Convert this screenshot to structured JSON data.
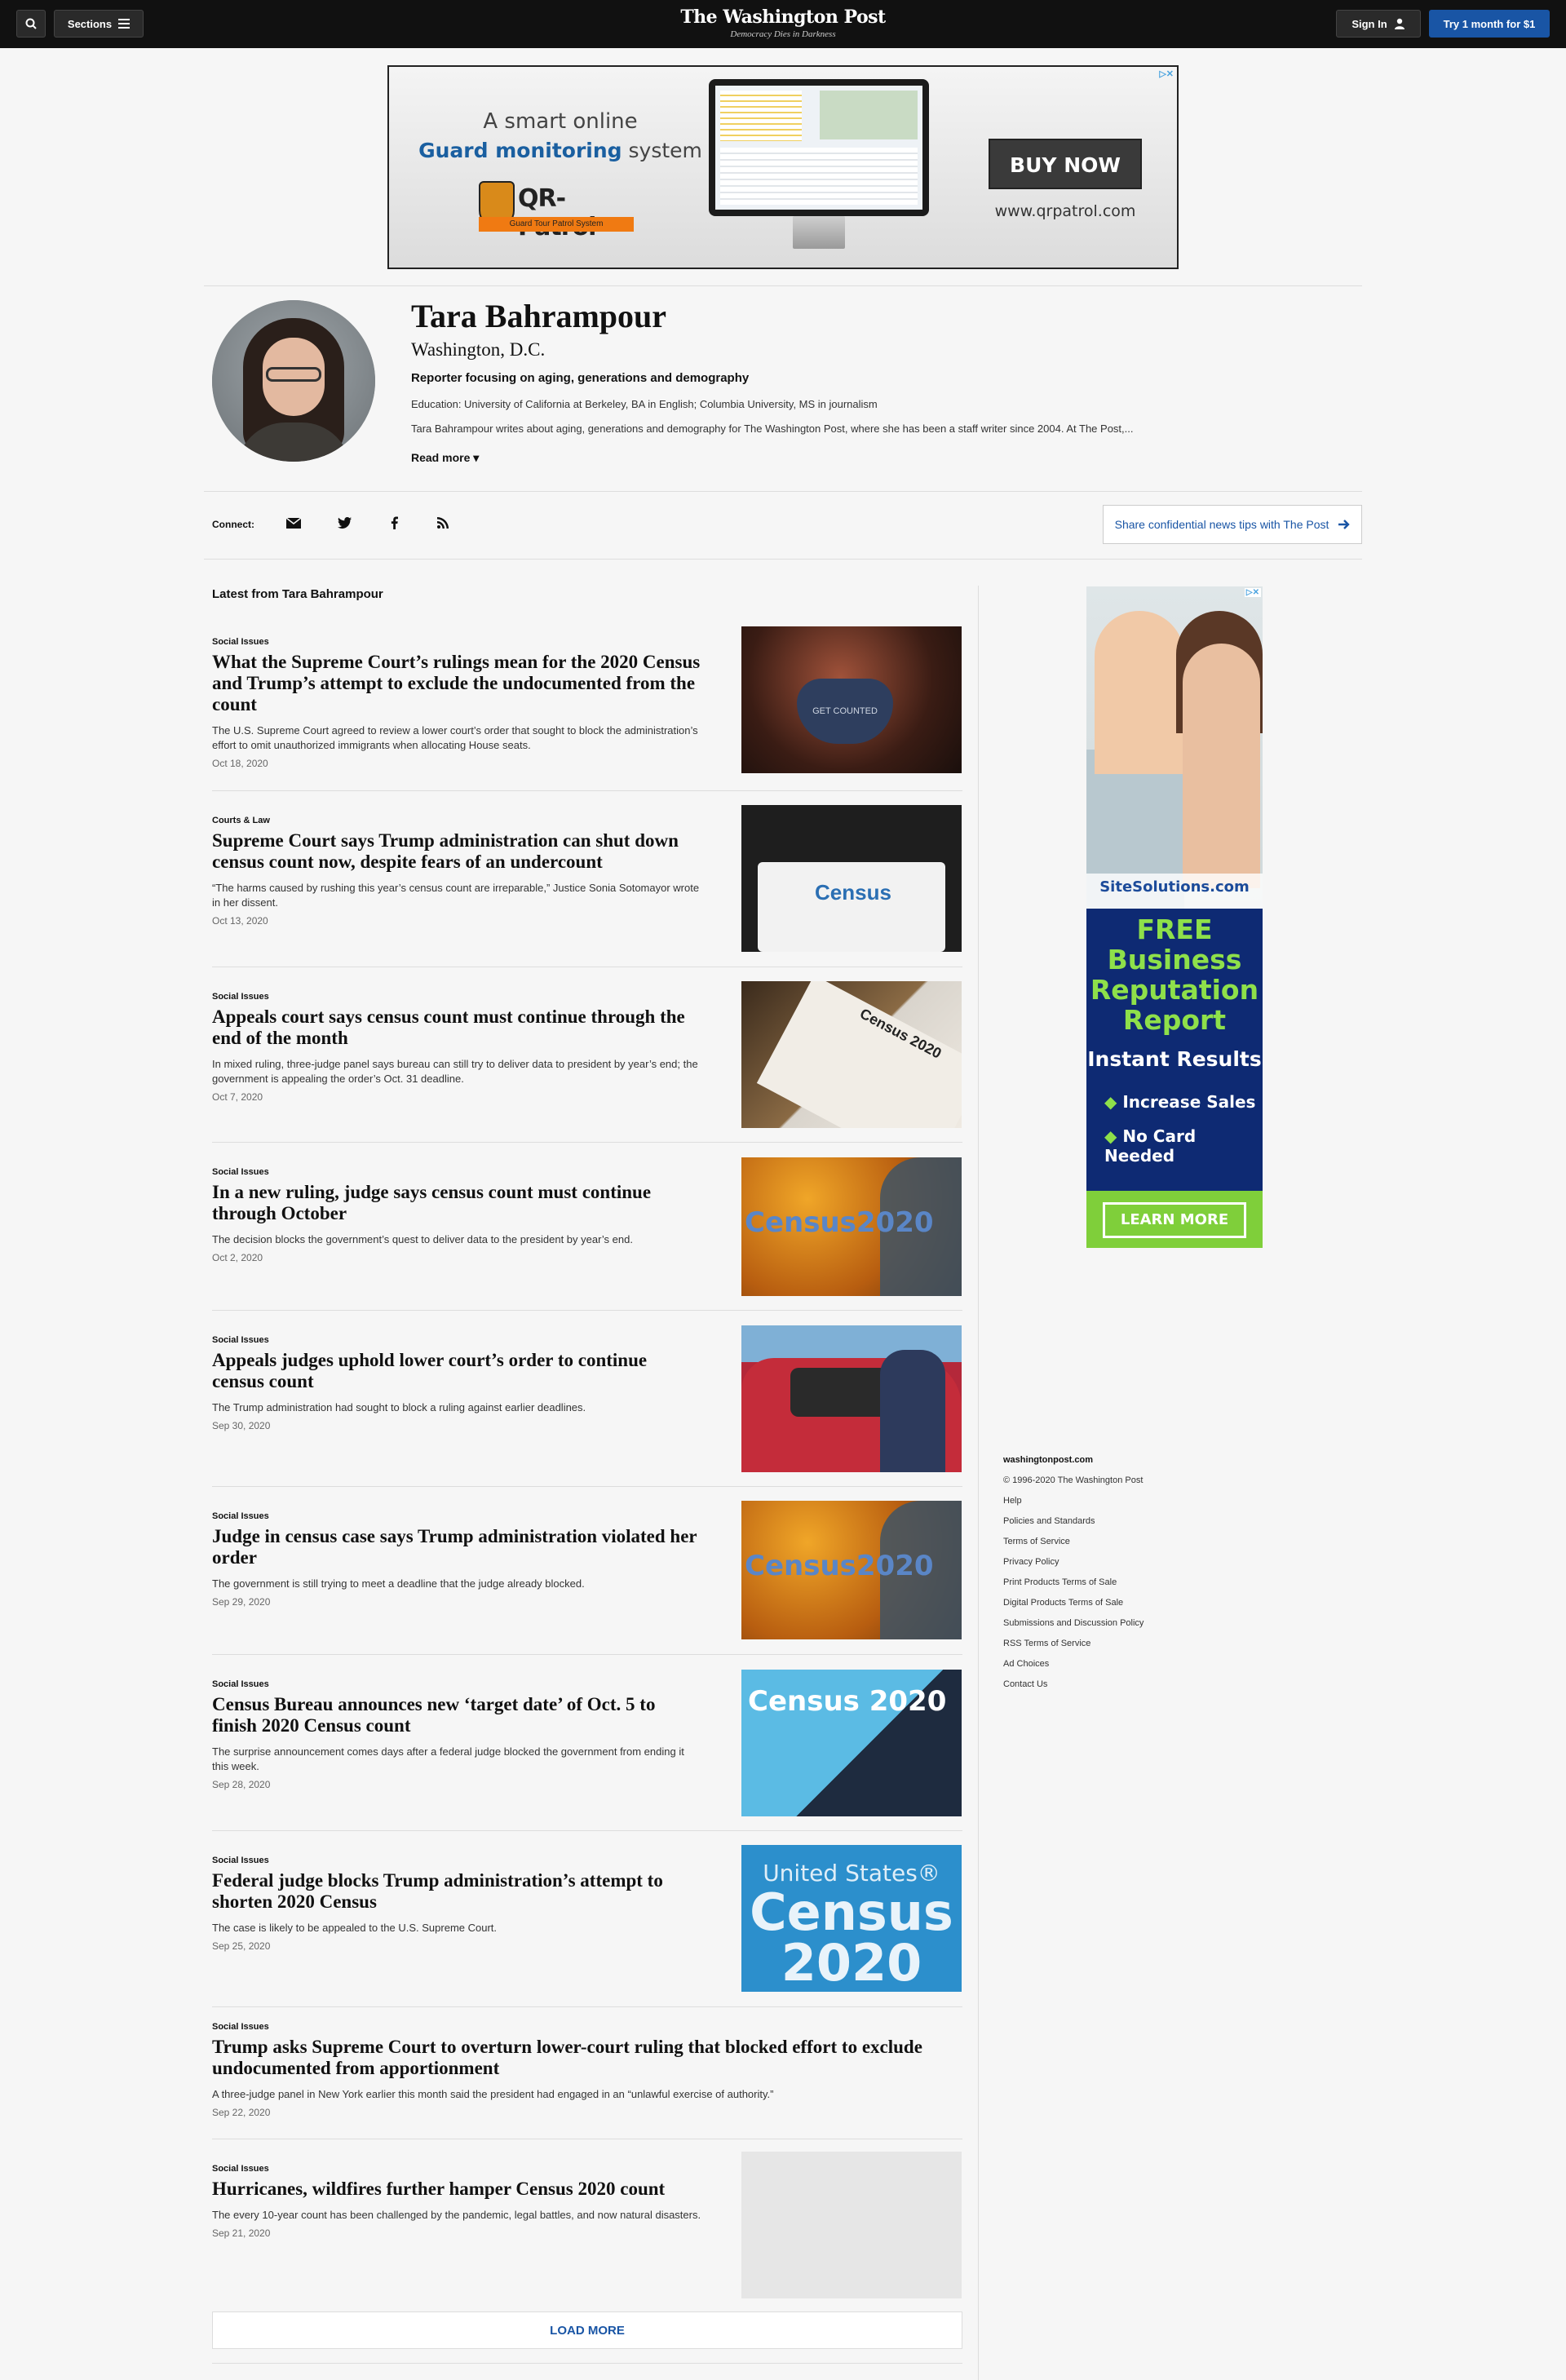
{
  "header": {
    "sections_label": "Sections",
    "masthead": "The Washington Post",
    "tagline": "Democracy Dies in Darkness",
    "signin_label": "Sign In",
    "subscribe_label": "Try 1 month for $1"
  },
  "top_ad": {
    "line1": "A smart online",
    "line2_bold": "Guard monitoring",
    "line2_rest": " system",
    "brand": "QR-Patrol",
    "brand_sub": "Guard Tour Patrol System",
    "cta": "BUY NOW",
    "url": "www.qrpatrol.com",
    "badge": "▷✕"
  },
  "author": {
    "name": "Tara Bahrampour",
    "location": "Washington, D.C.",
    "role": "Reporter focusing on aging, generations and demography",
    "education": "Education: University of California at Berkeley, BA in English; Columbia University, MS in journalism",
    "bio": "Tara Bahrampour writes about aging, generations and demography for The Washington Post, where she has been a staff writer since 2004. At The Post,...",
    "read_more": "Read more"
  },
  "connect": {
    "label": "Connect:",
    "icons": [
      "email-icon",
      "twitter-icon",
      "facebook-icon",
      "rss-icon"
    ],
    "tips_label": "Share confidential news tips with The Post"
  },
  "latest": {
    "title": "Latest from Tara Bahrampour",
    "articles": [
      {
        "kicker": "Social Issues",
        "headline": "What the Supreme Court’s rulings mean for the 2020 Census and Trump’s attempt to exclude the undocumented from the count",
        "blurb": "The U.S. Supreme Court agreed to review a lower court’s order that sought to block the administration’s effort to omit unauthorized immigrants when allocating House seats.",
        "date": "Oct 18, 2020",
        "thumb_text": "GET COUNTED"
      },
      {
        "kicker": "Courts & Law",
        "headline": "Supreme Court says Trump administration can shut down census count now, despite fears of an undercount",
        "blurb": "“The harms caused by rushing this year’s census count are irreparable,” Justice Sonia Sotomayor wrote in her dissent.",
        "date": "Oct 13, 2020",
        "thumb_text": "Census"
      },
      {
        "kicker": "Social Issues",
        "headline": "Appeals court says census count must continue through the end of the month",
        "blurb": "In mixed ruling, three-judge panel says bureau can still try to deliver data to president by year’s end; the government is appealing the order’s Oct. 31 deadline.",
        "date": "Oct 7, 2020",
        "thumb_text": "Census 2020"
      },
      {
        "kicker": "Social Issues",
        "headline": "In a new ruling, judge says census count must continue through October",
        "blurb": "The decision blocks the government’s quest to deliver data to the president by year’s end.",
        "date": "Oct 2, 2020",
        "thumb_text": "Census2020"
      },
      {
        "kicker": "Social Issues",
        "headline": "Appeals judges uphold lower court’s order to continue census count",
        "blurb": "The Trump administration had sought to block a ruling against earlier deadlines.",
        "date": "Sep 30, 2020"
      },
      {
        "kicker": "Social Issues",
        "headline": "Judge in census case says Trump administration violated her order",
        "blurb": "The government is still trying to meet a deadline that the judge already blocked.",
        "date": "Sep 29, 2020",
        "thumb_text": "Census2020"
      },
      {
        "kicker": "Social Issues",
        "headline": "Census Bureau announces new ‘target date’ of Oct. 5 to finish 2020 Census count",
        "blurb": "The surprise announcement comes days after a federal judge blocked the government from ending it this week.",
        "date": "Sep 28, 2020",
        "thumb_text": "Census 2020"
      },
      {
        "kicker": "Social Issues",
        "headline": "Federal judge blocks Trump administration’s attempt to shorten 2020 Census",
        "blurb": "The case is likely to be appealed to the U.S. Supreme Court.",
        "date": "Sep 25, 2020",
        "thumb_l1": "United States®",
        "thumb_l2": "Census",
        "thumb_l3": "2020"
      },
      {
        "kicker": "Social Issues",
        "headline": "Trump asks Supreme Court to overturn lower-court ruling that blocked effort to exclude undocumented from apportionment",
        "blurb": "A three-judge panel in New York earlier this month said the president had engaged in an “unlawful exercise of authority.”",
        "date": "Sep 22, 2020"
      },
      {
        "kicker": "Social Issues",
        "headline": "Hurricanes, wildfires further hamper Census 2020 count",
        "blurb": "The every 10-year count has been challenged by the pandemic, legal battles, and now natural disasters.",
        "date": "Sep 21, 2020"
      }
    ],
    "load_more": "LOAD MORE"
  },
  "side_ad": {
    "brand": "SiteSolutions.com",
    "line1": "FREE",
    "line2": "Business",
    "line3": "Reputation",
    "line4": "Report",
    "instant": "Instant Results",
    "bullet1": "Increase Sales",
    "bullet2": "No Card Needed",
    "cta": "LEARN MORE",
    "badge": "▷✕"
  },
  "footer": {
    "brand": "washingtonpost.com",
    "copyright": "© 1996-2020 The Washington Post",
    "links": [
      "Help",
      "Policies and Standards",
      "Terms of Service",
      "Privacy Policy",
      "Print Products Terms of Sale",
      "Digital Products Terms of Sale",
      "Submissions and Discussion Policy",
      "RSS Terms of Service",
      "Ad Choices",
      "Contact Us"
    ]
  },
  "colors": {
    "accent": "#1955a5",
    "topbar": "#111111",
    "background": "#f6f6f6"
  }
}
